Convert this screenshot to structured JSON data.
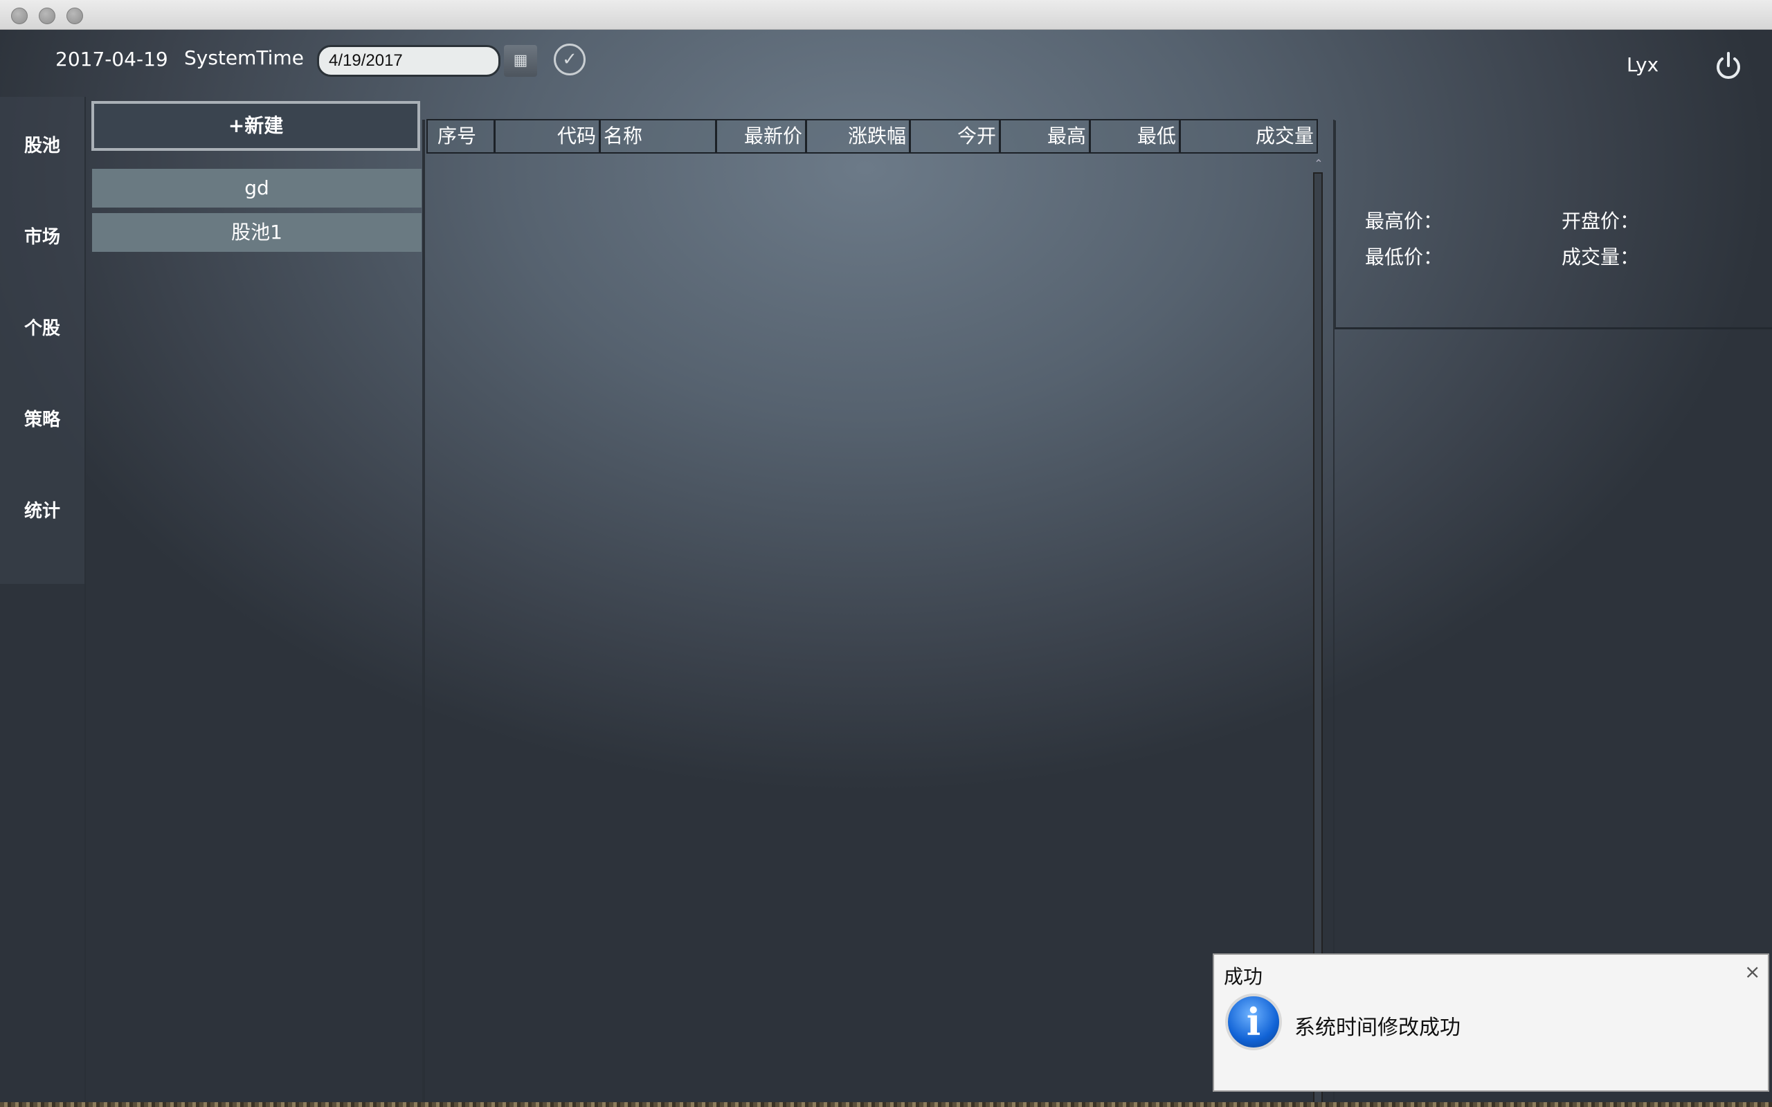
{
  "header": {
    "date": "2017-04-19",
    "system_time_label": "SystemTime",
    "date_input_value": "4/19/2017",
    "calendar_icon": "calendar-icon",
    "confirm_icon": "check-circle-icon",
    "user": "Lyx",
    "power_icon": "power-icon"
  },
  "nav": {
    "items": [
      {
        "label": "股池"
      },
      {
        "label": "市场"
      },
      {
        "label": "个股"
      },
      {
        "label": "策略"
      },
      {
        "label": "统计"
      }
    ]
  },
  "pool_panel": {
    "new_button": "+新建",
    "pools": [
      "gd",
      "股池1"
    ]
  },
  "table": {
    "columns": [
      "序号",
      "代码",
      "名称",
      "最新价",
      "涨跌幅",
      "今开",
      "最高",
      "最低",
      "成交量"
    ],
    "rows": []
  },
  "info": {
    "high_label": "最高价：",
    "open_label": "开盘价：",
    "low_label": "最低价：",
    "volume_label": "成交量："
  },
  "toast": {
    "title": "成功",
    "message": "系统时间修改成功",
    "icon": "info-icon",
    "close": "×"
  }
}
